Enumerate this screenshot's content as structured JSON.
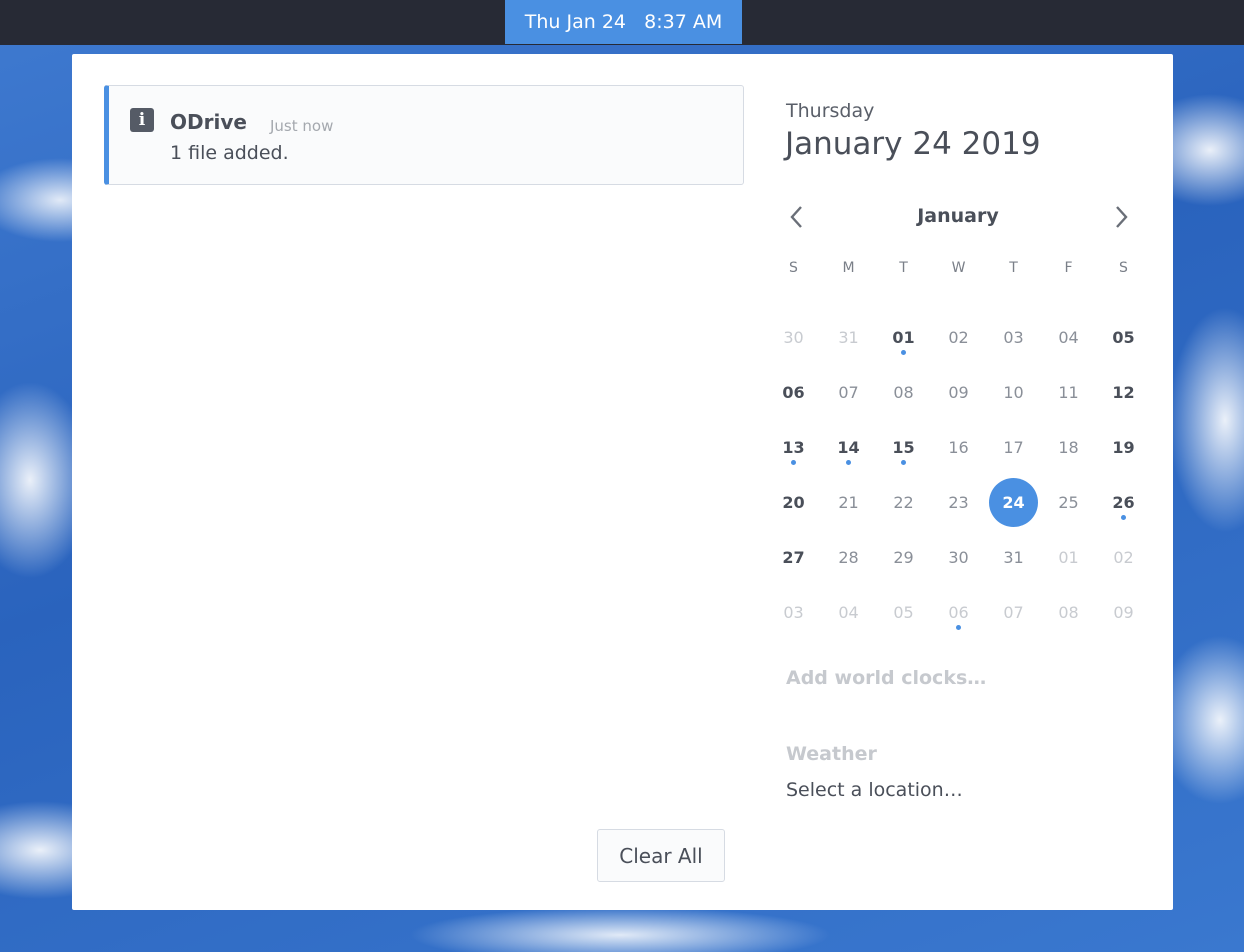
{
  "topbar": {
    "clock": "Thu Jan 24   8:37 AM"
  },
  "notification": {
    "app": "ODrive",
    "time": "Just now",
    "body": "1 file added.",
    "icon": "info-icon"
  },
  "clear_all": "Clear All",
  "calendar": {
    "day_name": "Thursday",
    "full_date": "January 24 2019",
    "month": "January",
    "weekdays": [
      "S",
      "M",
      "T",
      "W",
      "T",
      "F",
      "S"
    ],
    "days": [
      {
        "n": "30",
        "muted": true
      },
      {
        "n": "31",
        "muted": true
      },
      {
        "n": "01",
        "bold": true,
        "dot": true
      },
      {
        "n": "02"
      },
      {
        "n": "03"
      },
      {
        "n": "04"
      },
      {
        "n": "05",
        "bold": true
      },
      {
        "n": "06",
        "bold": true
      },
      {
        "n": "07"
      },
      {
        "n": "08"
      },
      {
        "n": "09"
      },
      {
        "n": "10"
      },
      {
        "n": "11"
      },
      {
        "n": "12",
        "bold": true
      },
      {
        "n": "13",
        "bold": true,
        "dot": true
      },
      {
        "n": "14",
        "bold": true,
        "dot": true
      },
      {
        "n": "15",
        "bold": true,
        "dot": true
      },
      {
        "n": "16"
      },
      {
        "n": "17"
      },
      {
        "n": "18"
      },
      {
        "n": "19",
        "bold": true
      },
      {
        "n": "20",
        "bold": true
      },
      {
        "n": "21"
      },
      {
        "n": "22"
      },
      {
        "n": "23"
      },
      {
        "n": "24",
        "today": true
      },
      {
        "n": "25"
      },
      {
        "n": "26",
        "bold": true,
        "dot": true
      },
      {
        "n": "27",
        "bold": true
      },
      {
        "n": "28"
      },
      {
        "n": "29"
      },
      {
        "n": "30"
      },
      {
        "n": "31"
      },
      {
        "n": "01",
        "muted": true
      },
      {
        "n": "02",
        "muted": true
      },
      {
        "n": "03",
        "muted": true
      },
      {
        "n": "04",
        "muted": true
      },
      {
        "n": "05",
        "muted": true
      },
      {
        "n": "06",
        "muted": true,
        "dot": true
      },
      {
        "n": "07",
        "muted": true
      },
      {
        "n": "08",
        "muted": true
      },
      {
        "n": "09",
        "muted": true
      }
    ]
  },
  "world_clocks": "Add world clocks…",
  "weather": {
    "title": "Weather",
    "location": "Select a location…"
  },
  "colors": {
    "accent": "#4a90e2",
    "topbar": "#272a35",
    "text": "#4a4f59"
  }
}
